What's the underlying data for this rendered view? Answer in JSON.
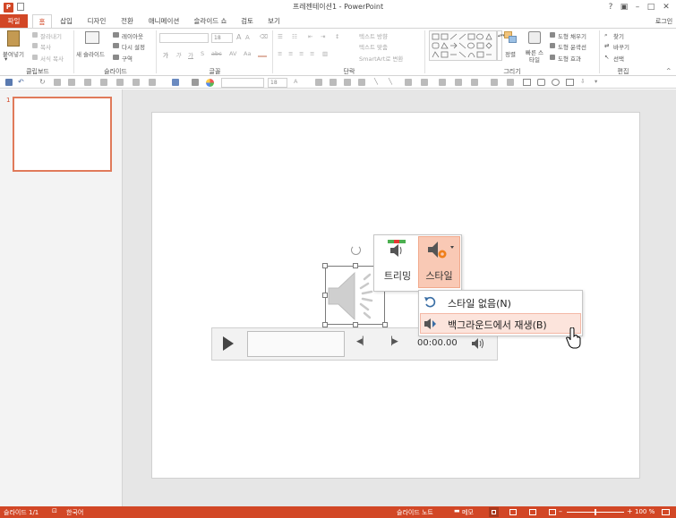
{
  "window": {
    "title": "프레젠테이션1 - PowerPoint",
    "app_icon": "P",
    "help": "?",
    "account": "로그인"
  },
  "tabs": [
    {
      "label": "파일",
      "kind": "file"
    },
    {
      "label": "홈",
      "kind": "active"
    },
    {
      "label": "삽입"
    },
    {
      "label": "디자인"
    },
    {
      "label": "전환"
    },
    {
      "label": "애니메이션"
    },
    {
      "label": "슬라이드 쇼"
    },
    {
      "label": "검토"
    },
    {
      "label": "보기"
    }
  ],
  "ribbon": {
    "clipboard": {
      "paste": "붙여넣기",
      "cut": "잘라내기",
      "copy": "복사",
      "format_painter": "서식 복사",
      "label": "클립보드"
    },
    "slides": {
      "new_slide": "새 슬라이드",
      "layout": "레이아웃",
      "reset": "다시 설정",
      "section": "구역",
      "label": "슬라이드"
    },
    "font": {
      "label": "글꼴",
      "font_name": "",
      "font_size": "18"
    },
    "paragraph": {
      "label": "단락",
      "text_direction": "텍스트 방향",
      "align_text": "텍스트 맞춤",
      "smartart": "SmartArt로 변환"
    },
    "drawing": {
      "label": "그리기",
      "arrange": "정렬",
      "quick_styles": "빠른 스타일",
      "fill": "도형 채우기",
      "outline": "도형 윤곽선",
      "effects": "도형 효과"
    },
    "editing": {
      "label": "편집",
      "find": "찾기",
      "replace": "바꾸기",
      "select": "선택"
    }
  },
  "quickaccess": {
    "font_size": "18"
  },
  "thumbnails": [
    {
      "number": "1"
    }
  ],
  "audio_toolbar": {
    "trim": "트리밍",
    "style": "스타일"
  },
  "dropdown": {
    "items": [
      {
        "label": "스타일 없음(N)",
        "icon": "undo-style-icon"
      },
      {
        "label": "백그라운드에서 재생(B)",
        "icon": "background-play-icon"
      }
    ]
  },
  "player": {
    "time": "00:00.00"
  },
  "statusbar": {
    "slide": "슬라이드 1/1",
    "language": "한국어",
    "notes": "슬라이드 노트",
    "comments": "메모",
    "zoom": "100 %"
  },
  "colors": {
    "accent": "#d24726",
    "highlight": "#fce4dc",
    "highlight_border": "#f4b8a6"
  }
}
